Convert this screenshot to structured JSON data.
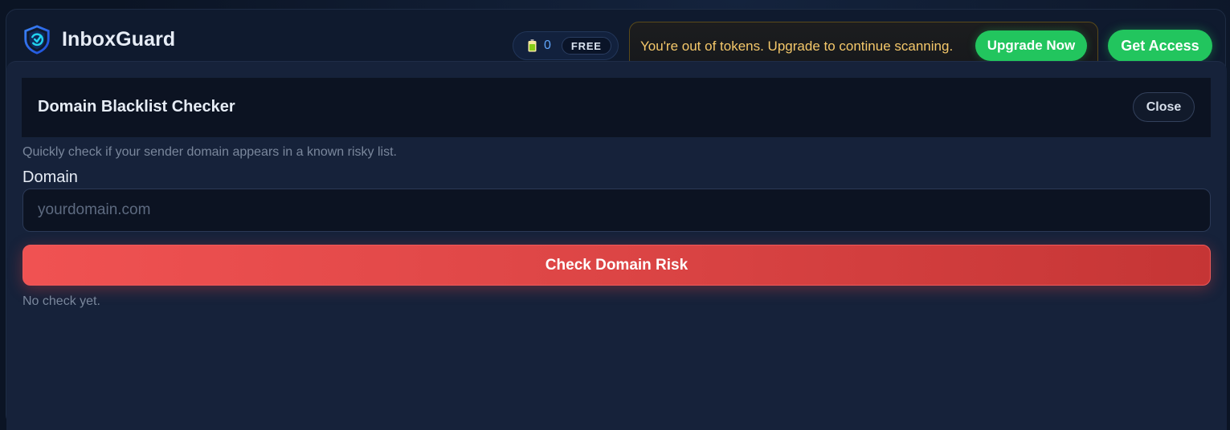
{
  "app": {
    "name": "InboxGuard"
  },
  "tokens": {
    "count": "0",
    "plan": "FREE"
  },
  "alert": {
    "message": "You're out of tokens. Upgrade to continue scanning.",
    "upgrade_label": "Upgrade Now"
  },
  "header": {
    "get_access_label": "Get Access"
  },
  "modal": {
    "title": "Domain Blacklist Checker",
    "close_label": "Close",
    "description": "Quickly check if your sender domain appears in a known risky list.",
    "field_label": "Domain",
    "input_value": "",
    "input_placeholder": "yourdomain.com",
    "check_label": "Check Domain Risk",
    "result_text": "No check yet."
  },
  "icons": {
    "logo": "shield-icon",
    "tokens": "battery-icon"
  },
  "colors": {
    "accent_green": "#22c55e",
    "danger_red": "#ef4444",
    "warning_text": "#f5c86a",
    "token_blue": "#60a5fa"
  }
}
